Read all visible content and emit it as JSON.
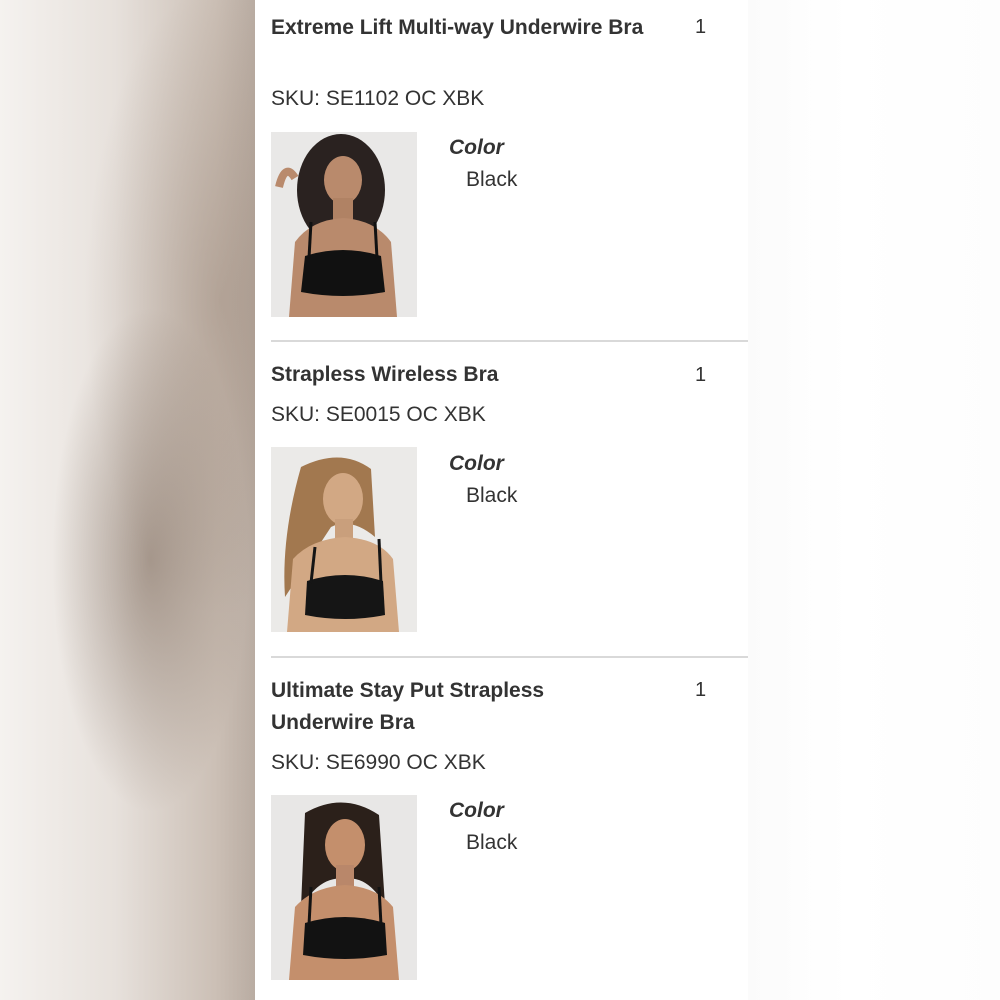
{
  "items": [
    {
      "title": "Extreme Lift Multi-way Underwire Bra",
      "qty": "1",
      "sku": "SKU: SE1102 OC XBK",
      "color_label": "Color",
      "color_value": "Black",
      "image": "product-photo-model-black-multiway-bra"
    },
    {
      "title": "Strapless Wireless Bra",
      "qty": "1",
      "sku": "SKU: SE0015 OC XBK",
      "color_label": "Color",
      "color_value": "Black",
      "image": "product-photo-model-black-strapless-wireless-bra"
    },
    {
      "title": "Ultimate Stay Put Strapless Underwire Bra",
      "qty": "1",
      "sku": "SKU: SE6990 OC XBK",
      "color_label": "Color",
      "color_value": "Black",
      "image": "product-photo-model-black-stay-put-strapless-bra"
    }
  ],
  "colors": {
    "text": "#333333",
    "divider": "#d9d9d9",
    "card_background": "#ffffff"
  }
}
